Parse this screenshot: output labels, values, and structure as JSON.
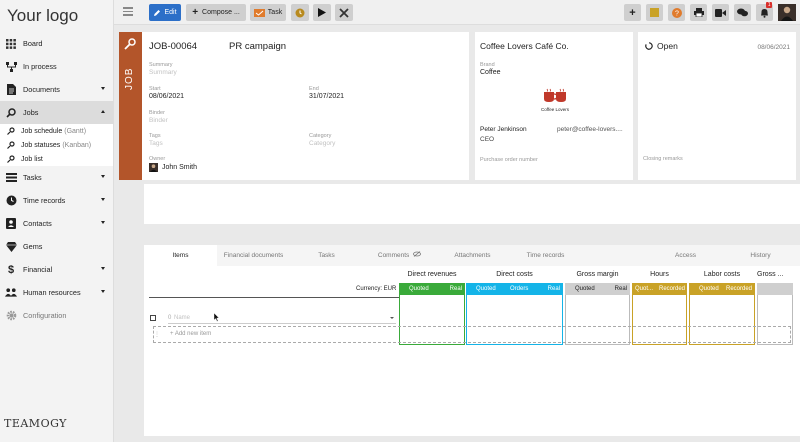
{
  "app": {
    "logo_text": "Your logo",
    "brand_mark": "TEAMOGY"
  },
  "sidebar": {
    "items": [
      {
        "label": "Board",
        "icon": "grid-icon"
      },
      {
        "label": "In process",
        "icon": "flow-icon"
      },
      {
        "label": "Documents",
        "icon": "document-icon"
      },
      {
        "label": "Jobs",
        "icon": "jobs-icon"
      },
      {
        "label": "Tasks",
        "icon": "tasks-icon"
      },
      {
        "label": "Time records",
        "icon": "clock-icon"
      },
      {
        "label": "Contacts",
        "icon": "contacts-icon"
      },
      {
        "label": "Gems",
        "icon": "gem-icon"
      },
      {
        "label": "Financial",
        "icon": "dollar-icon"
      },
      {
        "label": "Human resources",
        "icon": "people-icon"
      },
      {
        "label": "Configuration",
        "icon": "gear-icon"
      }
    ],
    "jobs_sub": [
      {
        "label": "Job schedule",
        "hint": "(Gantt)"
      },
      {
        "label": "Job statuses",
        "hint": "(Kanban)"
      },
      {
        "label": "Job list",
        "hint": ""
      }
    ]
  },
  "toolbar": {
    "edit_label": "Edit",
    "compose_label": "Compose ...",
    "task_label": "Task",
    "notification_count": "1"
  },
  "job": {
    "strip_label": "JOB",
    "code": "JOB-00064",
    "name": "PR campaign",
    "summary_label": "Summary",
    "summary_placeholder": "Summary",
    "start_label": "Start",
    "start_value": "08/06/2021",
    "end_label": "End",
    "end_value": "31/07/2021",
    "binder_label": "Binder",
    "binder_placeholder": "Binder",
    "tags_label": "Tags",
    "tags_placeholder": "Tags",
    "category_label": "Category",
    "category_placeholder": "Category",
    "owner_label": "Owner",
    "owner_value": "John Smith"
  },
  "client": {
    "name": "Coffee Lovers Café Co.",
    "brand_label": "Brand",
    "brand_value": "Coffee",
    "logo_caption": "Coffee Lovers",
    "contact_name": "Peter Jenkinson",
    "contact_email": "peter@coffee-lovers....",
    "contact_role": "CEO",
    "po_label": "Purchase order number"
  },
  "status": {
    "label": "Open",
    "date": "08/06/2021",
    "closing_label": "Closing remarks"
  },
  "tabs": [
    "Items",
    "Financial documents",
    "Tasks",
    "Comments",
    "Attachments",
    "Time records",
    "Access",
    "History"
  ],
  "grid": {
    "currency": "Currency: EUR",
    "name_placeholder": "Name",
    "qty_placeholder": "0",
    "add_item": "+ Add new item",
    "groups": [
      {
        "title": "Direct revenues",
        "sub": [
          "Quoted",
          "Real"
        ]
      },
      {
        "title": "Direct costs",
        "sub": [
          "Quoted",
          "Orders",
          "Real"
        ]
      },
      {
        "title": "Gross margin",
        "sub": [
          "Quoted",
          "Real"
        ]
      },
      {
        "title": "Hours",
        "sub": [
          "Quot...",
          "Recorded"
        ]
      },
      {
        "title": "Labor costs",
        "sub": [
          "Quoted",
          "Recorded"
        ]
      },
      {
        "title": "Gross ...",
        "sub": []
      }
    ]
  },
  "colors": {
    "accent_blue": "#2c6fc8",
    "job_strip": "#b3552a",
    "revenue_green": "#3aaa3a",
    "cost_cyan": "#14b4e8",
    "margin_grey": "#cfcfcf",
    "hours_gold": "#c9a227"
  }
}
